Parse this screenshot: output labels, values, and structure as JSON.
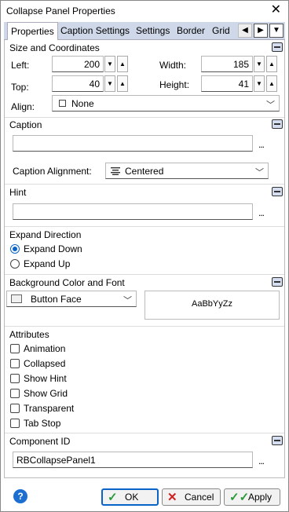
{
  "window": {
    "title": "Collapse Panel Properties"
  },
  "tabs": [
    "Properties",
    "Caption Settings",
    "Settings",
    "Border",
    "Grid"
  ],
  "size": {
    "title": "Size and Coordinates",
    "left_label": "Left:",
    "left_value": "200",
    "top_label": "Top:",
    "top_value": "40",
    "width_label": "Width:",
    "width_value": "185",
    "height_label": "Height:",
    "height_value": "41",
    "align_label": "Align:",
    "align_value": "None"
  },
  "caption": {
    "title": "Caption",
    "value": "",
    "alignment_label": "Caption Alignment:",
    "alignment_value": "Centered"
  },
  "hint": {
    "title": "Hint",
    "value": ""
  },
  "expand": {
    "title": "Expand Direction",
    "options": [
      "Expand Down",
      "Expand Up"
    ],
    "selected": "Expand Down"
  },
  "background": {
    "title": "Background Color and Font",
    "color_value": "Button Face",
    "preview_text": "AaBbYyZz"
  },
  "attributes": {
    "title": "Attributes",
    "items": [
      "Animation",
      "Collapsed",
      "Show Hint",
      "Show Grid",
      "Transparent",
      "Tab Stop"
    ]
  },
  "component": {
    "title": "Component ID",
    "value": "RBCollapsePanel1"
  },
  "buttons": {
    "ok": "OK",
    "cancel": "Cancel",
    "apply": "Apply"
  },
  "ellipsis": "...",
  "colors": {
    "tab_bar": "#cfd8e8",
    "accent": "#0a64c8",
    "help": "#1c6fd1",
    "ok_check": "#2a9a3a",
    "cancel_x": "#d02020"
  }
}
